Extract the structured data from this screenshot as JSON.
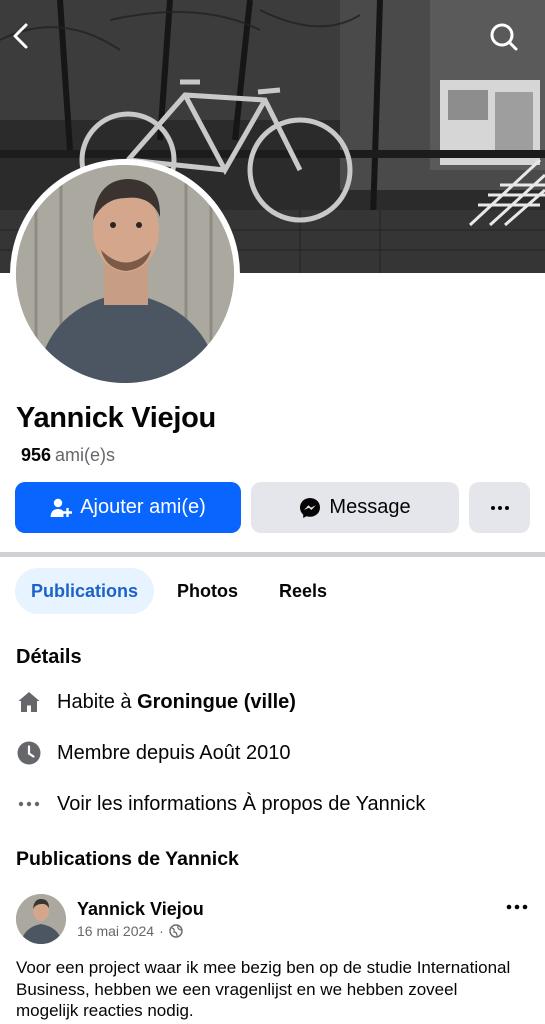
{
  "header": {
    "back_icon": "chevron-left-icon",
    "search_icon": "search-icon"
  },
  "profile": {
    "name": "Yannick Viejou",
    "friends_count": "956",
    "friends_label": "ami(e)s"
  },
  "actions": {
    "add_friend": "Ajouter ami(e)",
    "message": "Message",
    "more": "..."
  },
  "tabs": [
    {
      "label": "Publications",
      "active": true
    },
    {
      "label": "Photos",
      "active": false
    },
    {
      "label": "Reels",
      "active": false
    }
  ],
  "details": {
    "title": "Détails",
    "lives_prefix": "Habite à ",
    "lives_city": "Groningue (ville)",
    "member_since": "Membre depuis Août 2010",
    "about": "Voir les informations À propos de Yannick"
  },
  "posts": {
    "title": "Publications de Yannick",
    "items": [
      {
        "author": "Yannick Viejou",
        "date": "16 mai 2024",
        "separator": "·",
        "text": "Voor een project waar ik mee bezig ben op de studie International Business, hebben we een vragenlijst en we hebben zoveel mogelijk reacties nodig."
      }
    ]
  },
  "colors": {
    "accent": "#0866ff",
    "tab_active_bg": "#e7f3ff",
    "tab_active_text": "#1b63c8",
    "button_gray": "#e4e6eb"
  }
}
